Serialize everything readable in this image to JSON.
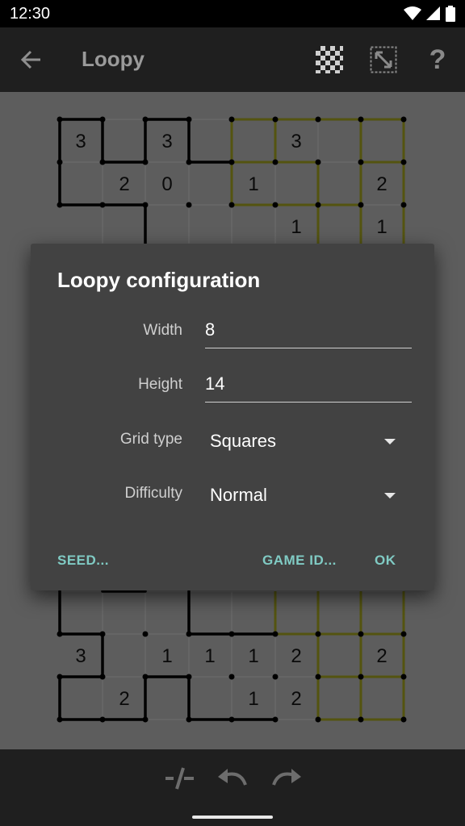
{
  "status_bar": {
    "time": "12:30",
    "icons": [
      "wifi-icon",
      "cellular-icon",
      "battery-icon"
    ]
  },
  "app_bar": {
    "title": "Loopy",
    "actions": [
      "checkerboard-icon",
      "resize-icon",
      "help-icon"
    ],
    "help_glyph": "?"
  },
  "board": {
    "visible_top_clues": [
      [
        "3",
        "",
        "3",
        "",
        "",
        "3",
        "",
        ""
      ],
      [
        "",
        "2",
        "0",
        "",
        "1",
        "",
        "",
        "2"
      ],
      [
        "",
        "",
        "",
        "",
        "",
        "1",
        "",
        "1"
      ]
    ],
    "visible_bottom_clues": [
      [
        "",
        "",
        "",
        "",
        "",
        "",
        "",
        ""
      ],
      [
        "3",
        "",
        "1",
        "1",
        "1",
        "2",
        "",
        "2"
      ],
      [
        "",
        "2",
        "",
        "",
        "1",
        "2",
        "",
        ""
      ]
    ]
  },
  "dialog": {
    "title": "Loopy configuration",
    "fields": {
      "width": {
        "label": "Width",
        "value": "8"
      },
      "height": {
        "label": "Height",
        "value": "14"
      },
      "grid_type": {
        "label": "Grid type",
        "value": "Squares"
      },
      "difficulty": {
        "label": "Difficulty",
        "value": "Normal"
      }
    },
    "buttons": {
      "seed": "SEED...",
      "game_id": "GAME ID...",
      "ok": "OK"
    },
    "accent_color": "#80cbc4"
  },
  "bottom_bar": {
    "actions": [
      "line-toggle-icon",
      "undo-icon",
      "redo-icon"
    ]
  }
}
